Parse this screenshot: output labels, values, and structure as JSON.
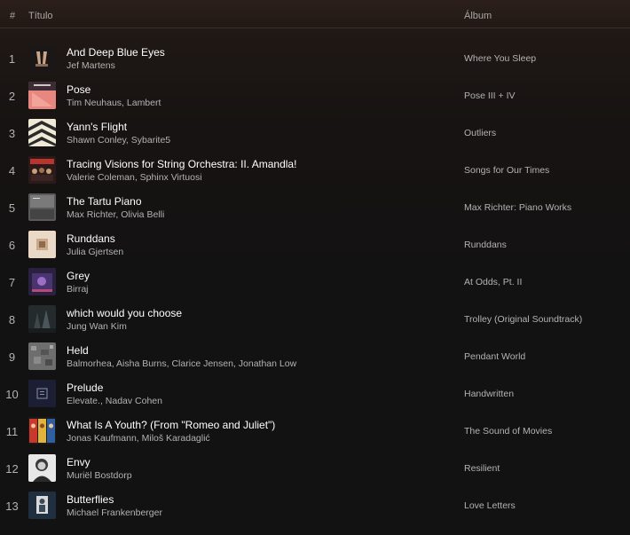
{
  "header": {
    "number_label": "#",
    "title_label": "Título",
    "album_label": "Álbum"
  },
  "tracks": [
    {
      "number": "1",
      "title": "And Deep Blue Eyes",
      "artists": "Jef Martens",
      "album": "Where You Sleep",
      "cover_icon": "album-cover-hands"
    },
    {
      "number": "2",
      "title": "Pose",
      "artists": "Tim Neuhaus, Lambert",
      "album": "Pose III + IV",
      "cover_icon": "album-cover-pink"
    },
    {
      "number": "3",
      "title": "Yann's Flight",
      "artists": "Shawn Conley, Sybarite5",
      "album": "Outliers",
      "cover_icon": "album-cover-chevrons"
    },
    {
      "number": "4",
      "title": "Tracing Visions for String Orchestra: II. Amandla!",
      "artists": "Valerie Coleman, Sphinx Virtuosi",
      "album": "Songs for Our Times",
      "cover_icon": "album-cover-orchestra"
    },
    {
      "number": "5",
      "title": "The Tartu Piano",
      "artists": "Max Richter, Olivia Belli",
      "album": "Max Richter: Piano Works",
      "cover_icon": "album-cover-grey"
    },
    {
      "number": "6",
      "title": "Runddans",
      "artists": "Julia Gjertsen",
      "album": "Runddans",
      "cover_icon": "album-cover-beige"
    },
    {
      "number": "7",
      "title": "Grey",
      "artists": "Birraj",
      "album": "At Odds, Pt. II",
      "cover_icon": "album-cover-purple"
    },
    {
      "number": "8",
      "title": "which would you choose",
      "artists": "Jung Wan Kim",
      "album": "Trolley (Original Soundtrack)",
      "cover_icon": "album-cover-dark-trees"
    },
    {
      "number": "9",
      "title": "Held",
      "artists": "Balmorhea, Aisha Burns, Clarice Jensen, Jonathan Low",
      "album": "Pendant World",
      "cover_icon": "album-cover-noise"
    },
    {
      "number": "10",
      "title": "Prelude",
      "artists": "Elevate., Nadav Cohen",
      "album": "Handwritten",
      "cover_icon": "album-cover-navy"
    },
    {
      "number": "11",
      "title": "What Is A Youth? (From \"Romeo and Juliet\")",
      "artists": "Jonas Kaufmann, Miloš Karadaglić",
      "album": "The Sound of Movies",
      "cover_icon": "album-cover-movie-posters"
    },
    {
      "number": "12",
      "title": "Envy",
      "artists": "Muriël Bostdorp",
      "album": "Resilient",
      "cover_icon": "album-cover-portrait"
    },
    {
      "number": "13",
      "title": "Butterflies",
      "artists": "Michael Frankenberger",
      "album": "Love Letters",
      "cover_icon": "album-cover-blue-figure"
    }
  ],
  "colors": {
    "background": "#121212",
    "header_tint": "#2b1f1a",
    "primary_text": "#ffffff",
    "secondary_text": "#b3b3b3"
  }
}
